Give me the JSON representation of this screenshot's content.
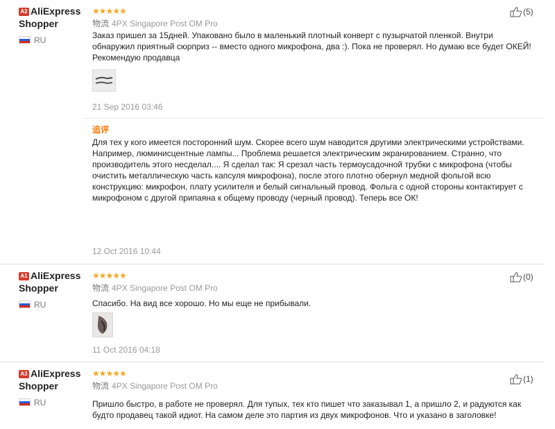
{
  "reviews": [
    {
      "username": "AliExpress Shopper",
      "level_badge": "A2",
      "country": "RU",
      "stars": "★★★★★",
      "logistics_label": "物流",
      "logistics": "4PX Singapore Post OM Pro",
      "text": "Заказ пришел за 15дней. Упаковано было в маленький плотный конверт с пузырчатой пленкой. Внутри обнаружил приятный сюрприз -- вместо одного микрофона, два :). Пока не проверял. Но думаю все будет ОКЕЙ! Рекомендую продавца",
      "date": "21 Sep 2016 03:46",
      "helpful_count": "(5)",
      "followup": {
        "label": "追评",
        "text": "Для тех у кого имеется посторонний шум. Скорее всего шум наводится другими электрическими устройствами. Например, люминисцентные лампы... Проблема решается электрическим экранированием. Странно, что производитель этого несделал.... Я сделал так: Я срезал часть термоусадочной трубки с микрофона (чтобы очистить металлическую часть капсуля микрофона), после этого плотно обернул медной фольгой всю конструкцию: микрофон, плату усилителя и белый сигнальный провод. Фольга с одной стороны контактирует с микрофоном с другой припаяна к общему проводу (черный провод). Теперь все ОК!",
        "date": "12 Oct 2016 10:44"
      }
    },
    {
      "username": "AliExpress Shopper",
      "level_badge": "A1",
      "country": "RU",
      "stars": "★★★★★",
      "logistics_label": "物流",
      "logistics": "4PX Singapore Post OM Pro",
      "text": "Спасибо. На вид все хорошо. Но мы еще не прибывали.",
      "date": "11 Oct 2016 04:18",
      "helpful_count": "(0)"
    },
    {
      "username": "AliExpress Shopper",
      "level_badge": "A3",
      "country": "RU",
      "stars": "★★★★★",
      "logistics_label": "物流",
      "logistics": "4PX Singapore Post OM Pro",
      "text": "Пришло быстро, в работе не проверял. Для тупых, тех кто пишет что заказывал 1, а пришло 2, и радуются как будто продавец такой идиот. На самом деле это партия из двух микрофонов. Что и указано в заголовке!",
      "helpful_count": "(1)"
    }
  ],
  "colors": {
    "accent_orange": "#ff7300",
    "star_color": "#f5a623",
    "badge_red": "#d33b2c"
  },
  "icons": [
    "thumbs-up-icon",
    "russia-flag-icon"
  ]
}
